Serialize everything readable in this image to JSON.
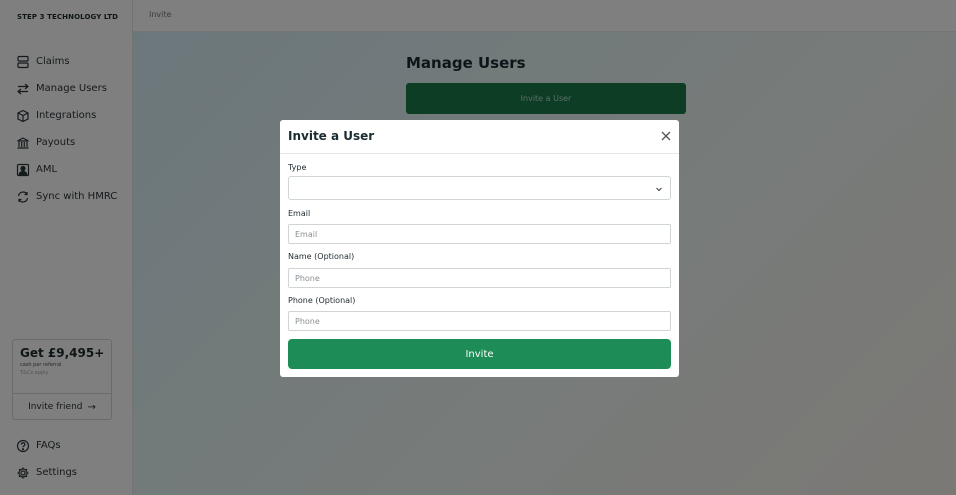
{
  "sidebar": {
    "company": "STEP 3 TECHNOLOGY LTD",
    "items": [
      {
        "label": "Claims",
        "icon": "claims-icon"
      },
      {
        "label": "Manage Users",
        "icon": "arrows-icon"
      },
      {
        "label": "Integrations",
        "icon": "cube-icon"
      },
      {
        "label": "Payouts",
        "icon": "bank-icon"
      },
      {
        "label": "AML",
        "icon": "person-icon"
      },
      {
        "label": "Sync with HMRC",
        "icon": "sync-icon"
      }
    ],
    "referral": {
      "amount": "Get £9,495+",
      "subtitle": "cash per referral",
      "note": "T&Cs apply",
      "button": "Invite friend",
      "arrow": "→"
    },
    "bottom_items": [
      {
        "label": "FAQs",
        "icon": "help-icon"
      },
      {
        "label": "Settings",
        "icon": "gear-icon"
      }
    ]
  },
  "topbar": {
    "breadcrumb": "Invite"
  },
  "main": {
    "title": "Manage Users",
    "invite_button": "Invite a User"
  },
  "modal": {
    "title": "Invite a User",
    "type_label": "Type",
    "type_value": "",
    "email_label": "Email",
    "email_placeholder": "Email",
    "name_label": "Name (Optional)",
    "name_placeholder": "Phone",
    "phone_label": "Phone (Optional)",
    "phone_placeholder": "Phone",
    "submit": "Invite"
  },
  "colors": {
    "accent": "#1e8c56",
    "overlay": "rgba(0,0,0,0.5)"
  }
}
